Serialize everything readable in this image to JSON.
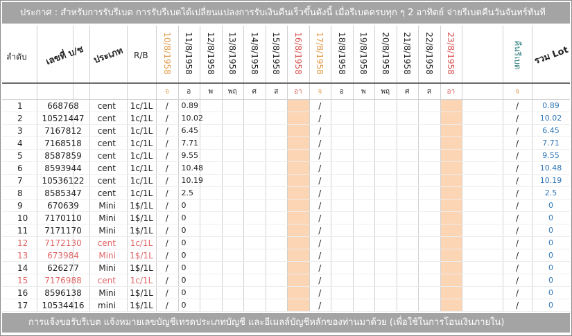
{
  "banner": "ประกาศ : สำหรับการรับรีเบต  การรับรีเบตได้เปลี่ยนแปลงการรับเงินคืนเร็วขึ้นดังนี้   เมื่อรีเบตครบทุก ๆ 2 อาทิตย์ จ่ายรีเบตคืนวันจันทร์ทันที",
  "footer": "การแจ้งขอรับรีเบต  แจ้งหมายเลขบัญชีเทรดประเภทบัญชี และอีเมลล์บัญชีหลักของท่านมาด้วย   (เพื่อใช้ในการโอนเงินภายใน)",
  "headers": {
    "order": "ลำดับ",
    "account": "เลขที่ บ/ช",
    "type": "ประเภท",
    "rb": "R/B",
    "rebate_return": "คืนรีเบต",
    "total_lot": "รวม Lot"
  },
  "dates": [
    {
      "label": "10/8/1958",
      "day": "จ",
      "color": "#e39a4a"
    },
    {
      "label": "11/8/1958",
      "day": "อ",
      "color": "#222222"
    },
    {
      "label": "12/8/1958",
      "day": "พ",
      "color": "#222222"
    },
    {
      "label": "13/8/1958",
      "day": "พฤ",
      "color": "#222222"
    },
    {
      "label": "14/8/1958",
      "day": "ศ",
      "color": "#222222"
    },
    {
      "label": "15/8/1958",
      "day": "ส",
      "color": "#222222"
    },
    {
      "label": "16/8/1958",
      "day": "อา",
      "color": "#d9534f"
    },
    {
      "label": "17/8/1958",
      "day": "จ",
      "color": "#e39a4a"
    },
    {
      "label": "18/8/1958",
      "day": "อ",
      "color": "#222222"
    },
    {
      "label": "19/8/1958",
      "day": "พ",
      "color": "#222222"
    },
    {
      "label": "20/8/1958",
      "day": "พฤ",
      "color": "#222222"
    },
    {
      "label": "21/8/1958",
      "day": "ศ",
      "color": "#222222"
    },
    {
      "label": "22/8/1958",
      "day": "ส",
      "color": "#222222"
    },
    {
      "label": "23/8/1958",
      "day": "อา",
      "color": "#d9534f"
    }
  ],
  "day_colors": {
    "จ": "#e39a4a",
    "อา": "#d9534f"
  },
  "rebate_day_mark": "จ",
  "slash": "/",
  "rows": [
    {
      "no": "1",
      "acc": "668768",
      "type": "cent",
      "rb": "1c/1L",
      "d11": "0.89",
      "total": "0.89",
      "red": false
    },
    {
      "no": "2",
      "acc": "10521447",
      "type": "cent",
      "rb": "1c/1L",
      "d11": "10.02",
      "total": "10.02",
      "red": false
    },
    {
      "no": "3",
      "acc": "7167812",
      "type": "cent",
      "rb": "1c/1L",
      "d11": "6.45",
      "total": "6.45",
      "red": false
    },
    {
      "no": "4",
      "acc": "7168518",
      "type": "cent",
      "rb": "1c/1L",
      "d11": "7.71",
      "total": "7.71",
      "red": false
    },
    {
      "no": "5",
      "acc": "8587859",
      "type": "cent",
      "rb": "1c/1L",
      "d11": "9.55",
      "total": "9.55",
      "red": false
    },
    {
      "no": "6",
      "acc": "8593944",
      "type": "cent",
      "rb": "1c/1L",
      "d11": "10.48",
      "total": "10.48",
      "red": false
    },
    {
      "no": "7",
      "acc": "10536122",
      "type": "cent",
      "rb": "1c/1L",
      "d11": "10.19",
      "total": "10.19",
      "red": false
    },
    {
      "no": "8",
      "acc": "8585347",
      "type": "cent",
      "rb": "1c/1L",
      "d11": "2.5",
      "total": "2.5",
      "red": false
    },
    {
      "no": "9",
      "acc": "670639",
      "type": "Mini",
      "rb": "1$/1L",
      "d11": "0",
      "total": "0",
      "red": false
    },
    {
      "no": "10",
      "acc": "7170110",
      "type": "Mini",
      "rb": "1$/1L",
      "d11": "0",
      "total": "0",
      "red": false
    },
    {
      "no": "11",
      "acc": "7171170",
      "type": "Mini",
      "rb": "1$/1L",
      "d11": "0",
      "total": "0",
      "red": false
    },
    {
      "no": "12",
      "acc": "7172130",
      "type": "cent",
      "rb": "1c/1L",
      "d11": "0",
      "total": "0",
      "red": true
    },
    {
      "no": "13",
      "acc": "673984",
      "type": "Mini",
      "rb": "1$/1L",
      "d11": "0",
      "total": "0",
      "red": true
    },
    {
      "no": "14",
      "acc": "626277",
      "type": "Mini",
      "rb": "1$/1L",
      "d11": "0",
      "total": "0",
      "red": false
    },
    {
      "no": "15",
      "acc": "7176988",
      "type": "cent",
      "rb": "1c/1L",
      "d11": "0",
      "total": "0",
      "red": true
    },
    {
      "no": "16",
      "acc": "8596138",
      "type": "Mini",
      "rb": "1$/1L",
      "d11": "0",
      "total": "0",
      "red": false
    },
    {
      "no": "17",
      "acc": "10534416",
      "type": "mini",
      "rb": "1$/1L",
      "d11": "0",
      "total": "0",
      "red": false
    }
  ],
  "colors": {
    "normal_text": "#222222",
    "red_text": "#e06666",
    "total_text": "#2e75b6",
    "weekend_shade": "#fcd5b5",
    "banner_bg": "#a4a4a4"
  }
}
